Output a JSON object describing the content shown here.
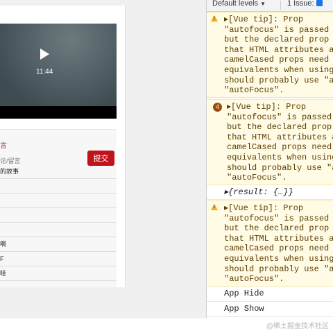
{
  "video": {
    "duration": "11:44"
  },
  "comments": {
    "header": "言",
    "hint": "论/留言",
    "submit_label": "提交",
    "rows": [
      "的故事",
      "",
      "",
      "",
      "",
      "啊",
      "F",
      "哇"
    ]
  },
  "devtools": {
    "levels_label": "Default levels",
    "issues_label": "1 Issue:",
    "messages": [
      {
        "type": "warning",
        "text": "▸[Vue tip]: Prop\n\"autofocus\" is passed to\nbut the declared prop na\nthat HTML attributes are\ncamelCased props need to\nequivalents when using i\nshould probably use \"au\n\"autoFocus\"."
      },
      {
        "type": "warning",
        "count": "4",
        "text": "▸[Vue tip]: Prop\n\"autofocus\" is passed t\nbut the declared prop n\nthat HTML attributes ar\ncamelCased props need t\nequivalents when using\nshould probably use \"aut\n\"autoFocus\"."
      },
      {
        "type": "log",
        "text": "▸{result: {…}}"
      },
      {
        "type": "warning",
        "text": "▸[Vue tip]: Prop\n\"autofocus\" is passed to\nbut the declared prop na\nthat HTML attributes are\ncamelCased props need to\nequivalents when using i\nshould probably use \"au\n\"autoFocus\"."
      },
      {
        "type": "log",
        "text": "App Hide"
      },
      {
        "type": "log",
        "text": "App Show"
      }
    ]
  },
  "watermark": "@稀土掘金技术社区"
}
